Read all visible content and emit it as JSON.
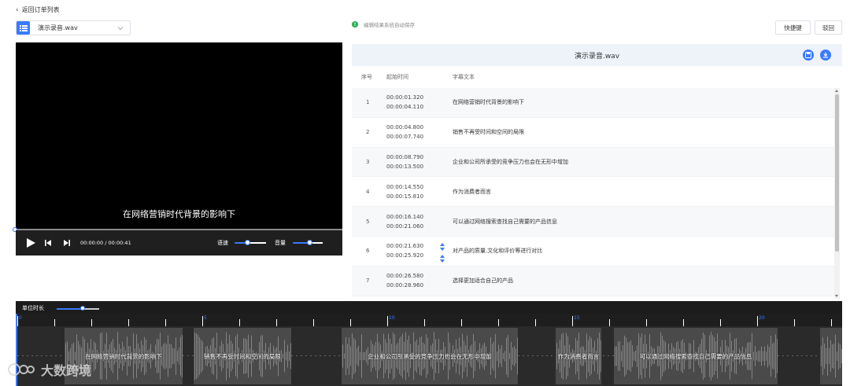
{
  "nav": {
    "back_label": "返回订单列表"
  },
  "file_select": {
    "value": "演示录音.wav"
  },
  "autosave": {
    "text": "编辑结果系统自动保存"
  },
  "toolbar": {
    "shortcut_label": "快捷键",
    "return_label": "驳回"
  },
  "player": {
    "subtitle": "在网络营销时代背景的影响下",
    "time": "00:00:00 / 00:00:41",
    "speed_label": "语速",
    "volume_label": "音量",
    "speed_level": 0.4,
    "volume_level": 0.55
  },
  "panel": {
    "title": "演示录音.wav",
    "columns": {
      "index": "序号",
      "start": "起始时间",
      "text": "字幕文本"
    },
    "rows": [
      {
        "index": "1",
        "start": "00:00:01.320",
        "end": "00:00:04.110",
        "text": "在网络营销时代背景的影响下"
      },
      {
        "index": "2",
        "start": "00:00:04.800",
        "end": "00:00:07.740",
        "text": "销售不再受时间和空间的局限"
      },
      {
        "index": "3",
        "start": "00:00:08.790",
        "end": "00:00:13.500",
        "text": "企业和公司所承受的竞争压力也会在无形中增加"
      },
      {
        "index": "4",
        "start": "00:00:14.550",
        "end": "00:00:15.810",
        "text": "作为消费者而言"
      },
      {
        "index": "5",
        "start": "00:00:16.140",
        "end": "00:00:21.060",
        "text": "可以通过网络搜索查找自己需要的产品信息"
      },
      {
        "index": "6",
        "start": "00:00:21.630",
        "end": "00:00:25.920",
        "text": "对产品的质量.文化和评价等进行对比"
      },
      {
        "index": "7",
        "start": "00:00:26.580",
        "end": "00:00:28.960",
        "text": "选择更加适合自己的产品"
      }
    ]
  },
  "timeline": {
    "unit_label": "单位时长",
    "ticks": [
      "0",
      "5",
      "10",
      "15",
      "20"
    ],
    "segments": [
      "在网络营销时代背景的影响下",
      "销售不再受时间和空间的局限",
      "企业和公司所承受的竞争压力也会在无形中增加",
      "作为消费者而言",
      "可以通过网络搜索查找自己需要的产品信息"
    ]
  },
  "watermark": {
    "text": "大数跨境"
  },
  "colors": {
    "accent": "#3a7afe",
    "success": "#22b14c",
    "video_bg": "#000000",
    "timeline_bg": "#2a2a2a"
  }
}
